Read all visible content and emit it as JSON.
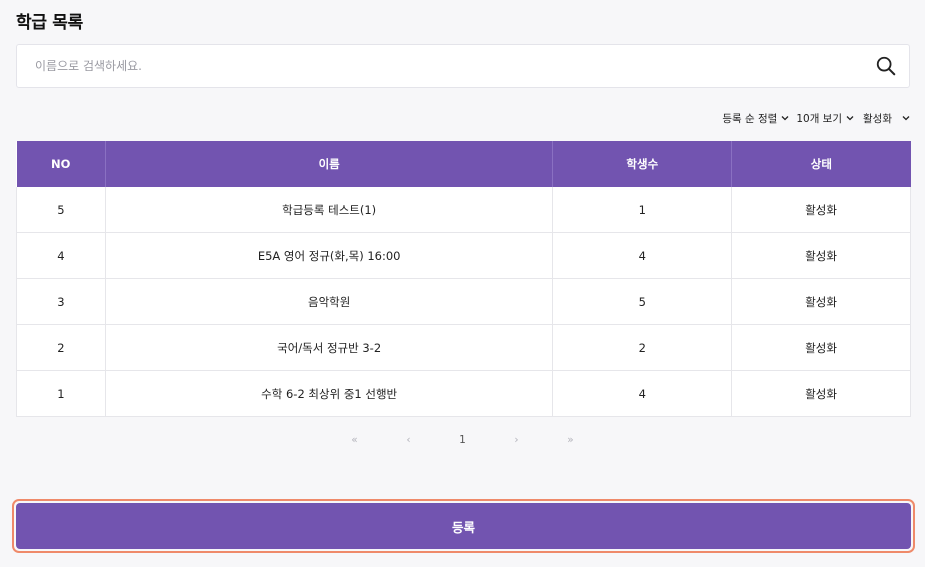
{
  "header": {
    "title": "학급 목록"
  },
  "search": {
    "placeholder": "이름으로 검색하세요.",
    "value": ""
  },
  "toolbar": {
    "sort_label": "등록 순 정렬",
    "page_size_label": "10개 보기",
    "status_filter_label": "활성화"
  },
  "table": {
    "columns": [
      "NO",
      "이름",
      "학생수",
      "상태"
    ],
    "rows": [
      {
        "no": "5",
        "name": "학급등록 테스트(1)",
        "students": "1",
        "status": "활성화"
      },
      {
        "no": "4",
        "name": "E5A 영어 정규(화,목) 16:00",
        "students": "4",
        "status": "활성화"
      },
      {
        "no": "3",
        "name": "음악학원",
        "students": "5",
        "status": "활성화"
      },
      {
        "no": "2",
        "name": "국어/독서 정규반 3-2",
        "students": "2",
        "status": "활성화"
      },
      {
        "no": "1",
        "name": "수학 6-2 최상위 중1 선행반",
        "students": "4",
        "status": "활성화"
      }
    ]
  },
  "pagination": {
    "first": "«",
    "prev": "‹",
    "current": "1",
    "next": "›",
    "last": "»"
  },
  "actions": {
    "register_label": "등록"
  },
  "colors": {
    "accent": "#7254b0",
    "focus_ring": "#ef8a6a",
    "background": "#f7f7f9"
  }
}
